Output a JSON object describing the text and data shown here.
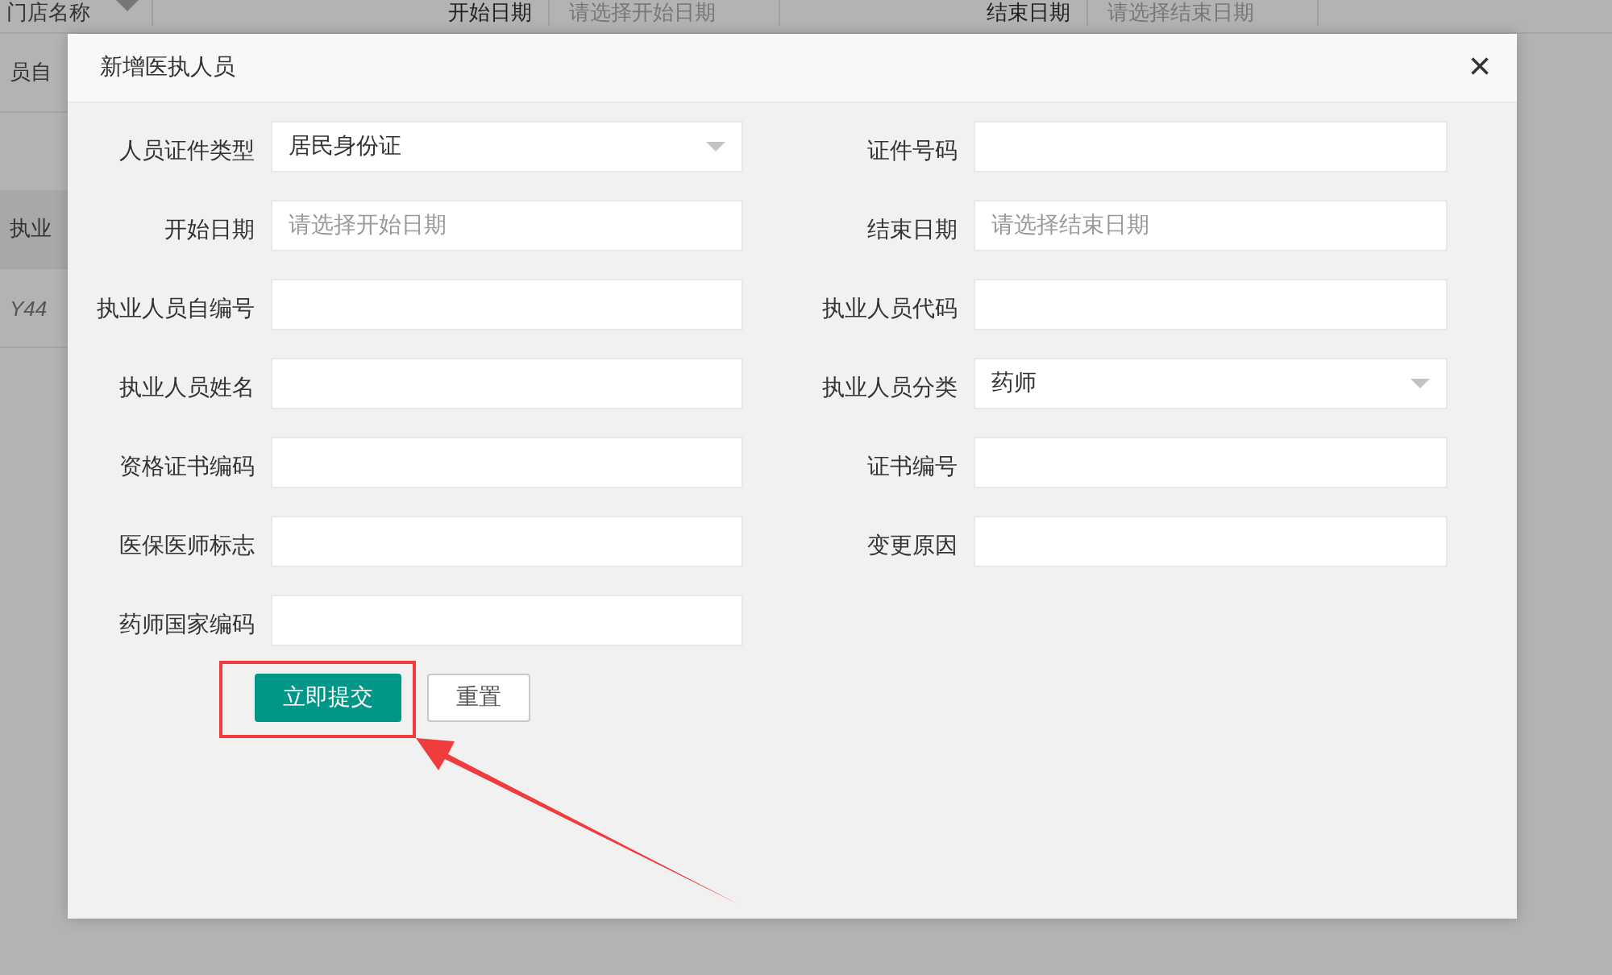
{
  "background": {
    "filters": [
      {
        "label": "门店名称",
        "kind": "select"
      },
      {
        "label": "开始日期",
        "placeholder": "请选择开始日期"
      },
      {
        "label": "结束日期",
        "placeholder": "请选择结束日期"
      }
    ],
    "side_texts": [
      "员自",
      "执业",
      "Y44"
    ]
  },
  "dialog": {
    "title": "新增医执人员",
    "close": "×",
    "fields": [
      {
        "label": "人员证件类型",
        "kind": "select",
        "value": "居民身份证"
      },
      {
        "label": "证件号码",
        "kind": "text"
      },
      {
        "label": "开始日期",
        "kind": "date",
        "placeholder": "请选择开始日期"
      },
      {
        "label": "结束日期",
        "kind": "date",
        "placeholder": "请选择结束日期"
      },
      {
        "label": "执业人员自编号",
        "kind": "text"
      },
      {
        "label": "执业人员代码",
        "kind": "text"
      },
      {
        "label": "执业人员姓名",
        "kind": "text"
      },
      {
        "label": "执业人员分类",
        "kind": "select",
        "value": "药师"
      },
      {
        "label": "资格证书编码",
        "kind": "text"
      },
      {
        "label": "证书编号",
        "kind": "text"
      },
      {
        "label": "医保医师标志",
        "kind": "text"
      },
      {
        "label": "变更原因",
        "kind": "text"
      },
      {
        "label": "药师国家编码",
        "kind": "text"
      }
    ],
    "buttons": [
      {
        "label": "立即提交",
        "kind": "primary",
        "highlighted": true
      },
      {
        "label": "重置",
        "kind": "plain",
        "highlighted": false
      }
    ]
  }
}
